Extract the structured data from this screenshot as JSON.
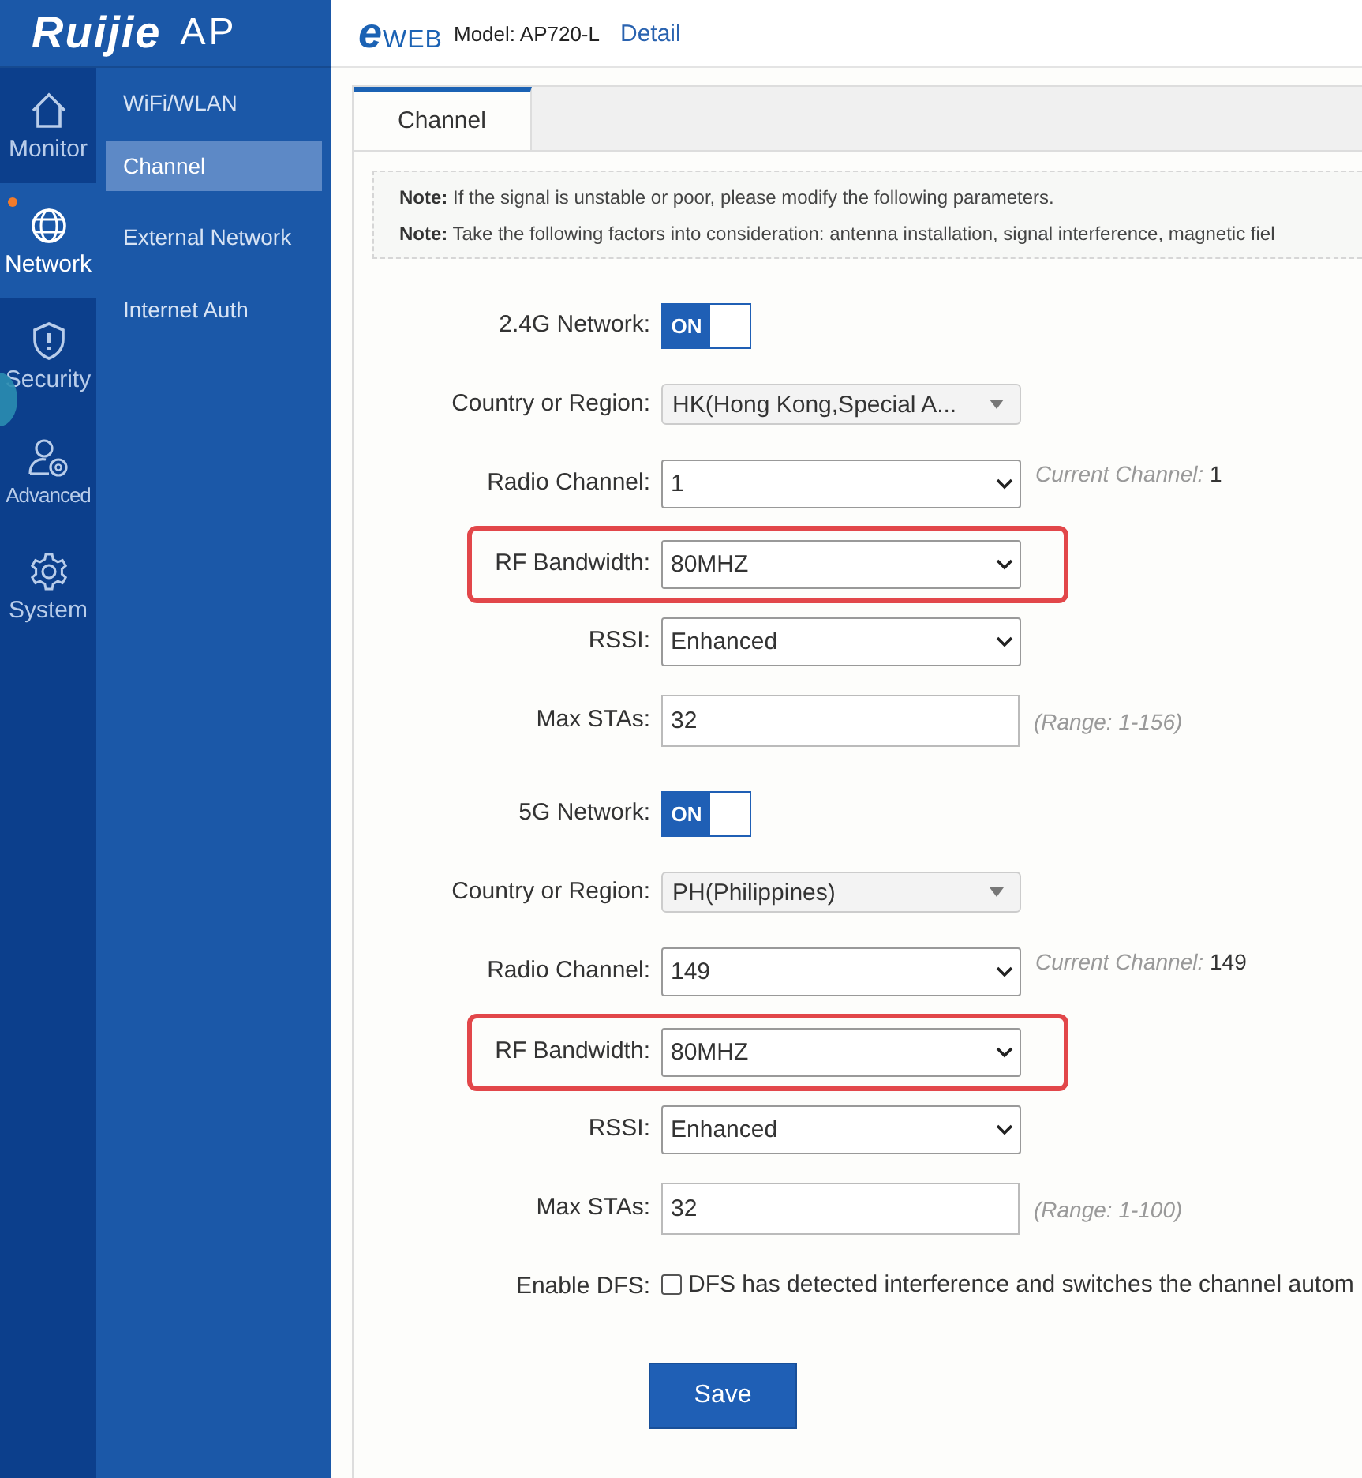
{
  "brand": {
    "logo": "Ruijie",
    "product": "AP"
  },
  "header": {
    "logo": "eWEB",
    "model": "Model: AP720-L",
    "detail_link": "Detail"
  },
  "rail": [
    {
      "label": "Monitor",
      "selected": false,
      "alert": false
    },
    {
      "label": "Network",
      "selected": true,
      "alert": true
    },
    {
      "label": "Security",
      "selected": false,
      "alert": false
    },
    {
      "label": "Advanced",
      "selected": false,
      "alert": false
    },
    {
      "label": "System",
      "selected": false,
      "alert": false
    }
  ],
  "submenu": [
    {
      "label": "WiFi/WLAN",
      "selected": false
    },
    {
      "label": "Channel",
      "selected": true
    },
    {
      "label": "External Network",
      "selected": false
    },
    {
      "label": "Internet Auth",
      "selected": false
    }
  ],
  "tabs": [
    {
      "label": "Channel",
      "selected": true
    }
  ],
  "notes": [
    "**Note:** If the signal is unstable or poor, please modify the following parameters.",
    "**Note:** Take the following factors into consideration: antenna installation, signal interference, magnetic fiel"
  ],
  "sections": [
    {
      "rows": [
        {
          "kind": "toggle",
          "label": "2.4G Network:",
          "value": "ON",
          "on": true,
          "highlighted": false
        },
        {
          "kind": "dropdown",
          "label": "Country or Region:",
          "value": "HK(Hong Kong,Special A...",
          "highlighted": false
        },
        {
          "kind": "select",
          "label": "Radio Channel:",
          "value": "1",
          "hint": "*Current Channel:* 1",
          "highlighted": false
        },
        {
          "kind": "select",
          "label": "RF Bandwidth:",
          "value": "80MHZ",
          "highlighted": true
        },
        {
          "kind": "select",
          "label": "RSSI:",
          "value": "Enhanced",
          "highlighted": false
        },
        {
          "kind": "input",
          "label": "Max STAs:",
          "value": "32",
          "hint": "*(Range: 1-156)*",
          "highlighted": false
        }
      ]
    },
    {
      "rows": [
        {
          "kind": "toggle",
          "label": "5G Network:",
          "value": "ON",
          "on": true,
          "highlighted": false
        },
        {
          "kind": "dropdown",
          "label": "Country or Region:",
          "value": "PH(Philippines)",
          "highlighted": false
        },
        {
          "kind": "select",
          "label": "Radio Channel:",
          "value": "149",
          "hint": "*Current Channel:* 149",
          "highlighted": false
        },
        {
          "kind": "select",
          "label": "RF Bandwidth:",
          "value": "80MHZ",
          "highlighted": true
        },
        {
          "kind": "select",
          "label": "RSSI:",
          "value": "Enhanced",
          "highlighted": false
        },
        {
          "kind": "input",
          "label": "Max STAs:",
          "value": "32",
          "hint": "*(Range: 1-100)*",
          "highlighted": false
        },
        {
          "kind": "checkbox",
          "label": "Enable DFS:",
          "value": "DFS has detected interference and switches the channel autom",
          "checked": false,
          "highlighted": false
        }
      ]
    }
  ],
  "save_button": "Save"
}
